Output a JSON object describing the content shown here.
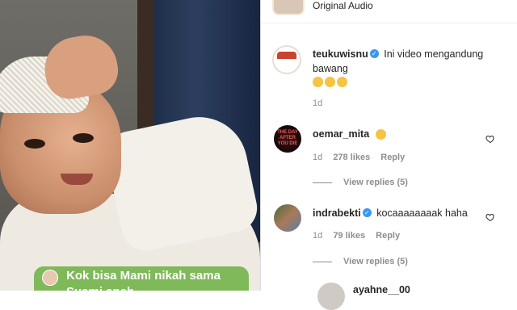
{
  "video": {
    "caption_text": "Kok bisa Mami nikah sama Suami aneh"
  },
  "header": {
    "audio_label": "Original Audio"
  },
  "post": {
    "username": "teukuwisnu",
    "text_line1": "Ini video mengandung",
    "text_line2": "bawang",
    "time": "1d"
  },
  "comments": [
    {
      "username": "oemar_mita",
      "avatar_text": "THE DAY AFTER YOU DIE",
      "time": "1d",
      "likes": "278 likes",
      "reply": "Reply",
      "view_replies": "View replies (5)"
    },
    {
      "username": "indrabekti",
      "text": "kocaaaaaaaak haha",
      "time": "1d",
      "likes": "79 likes",
      "reply": "Reply",
      "view_replies": "View replies (5)"
    }
  ],
  "next_comment": {
    "username": "ayahne__00"
  },
  "colors": {
    "verified": "#3897f0",
    "caption_bg": "#7fb95a",
    "meta_text": "#8e8e8e"
  }
}
